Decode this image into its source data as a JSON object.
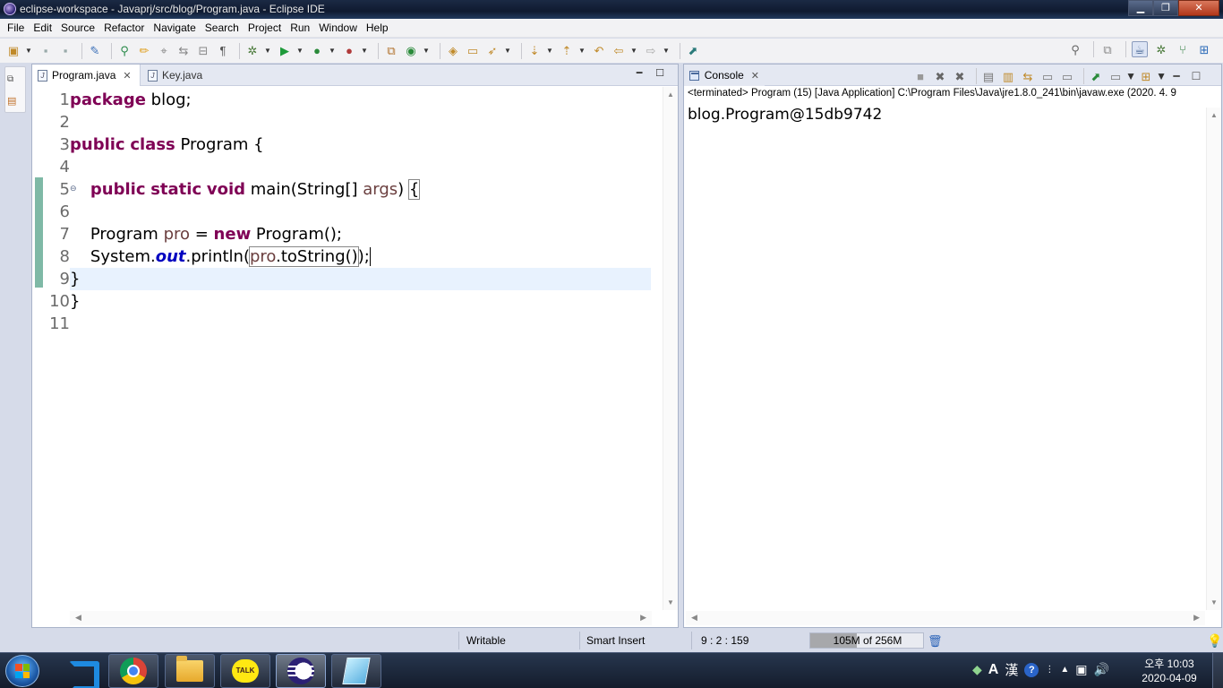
{
  "window": {
    "title": "eclipse-workspace - Javaprj/src/blog/Program.java - Eclipse IDE",
    "minimize_glyph": "▁",
    "maximize_glyph": "❐",
    "close_glyph": "✕"
  },
  "menu": [
    "File",
    "Edit",
    "Source",
    "Refactor",
    "Navigate",
    "Search",
    "Project",
    "Run",
    "Window",
    "Help"
  ],
  "editor": {
    "tabs": [
      {
        "label": "Program.java",
        "active": true
      },
      {
        "label": "Key.java",
        "active": false
      }
    ],
    "tab_close_glyph": "✕",
    "minimize_glyph": "━",
    "maximize_glyph": "☐",
    "line_numbers": [
      "1",
      "2",
      "3",
      "4",
      "5",
      "6",
      "7",
      "8",
      "9",
      "10",
      "11"
    ],
    "fold_glyph": "⊖",
    "code": {
      "l1_kw": "package",
      "l1_rest": " blog;",
      "l3_kw1": "public",
      "l3_kw2": "class",
      "l3_rest": " Program {",
      "l5_indent": "    ",
      "l5_kw1": "public",
      "l5_kw2": "static",
      "l5_kw3": "void",
      "l5_rest": " main(String[] ",
      "l5_param": "args",
      "l5_close": ") ",
      "l5_brace": "{",
      "l7_indent": "    ",
      "l7_type": "Program ",
      "l7_var": "pro",
      "l7_eq": " = ",
      "l7_kw": "new",
      "l7_rest": " Program();",
      "l8_indent": "    ",
      "l8_sys": "System.",
      "l8_field": "out",
      "l8_method": ".println(",
      "l8_arg_var": "pro",
      "l8_arg_rest": ".toString()",
      "l8_end": ");",
      "l9": "}",
      "l10": "}"
    }
  },
  "console": {
    "tab_label": "Console",
    "status": "<terminated> Program (15) [Java Application] C:\\Program Files\\Java\\jre1.8.0_241\\bin\\javaw.exe (2020. 4. 9",
    "output": "blog.Program@15db9742"
  },
  "statusbar": {
    "writable": "Writable",
    "insert_mode": "Smart Insert",
    "position": "9 : 2 : 159",
    "heap_used": "105M of 256M",
    "heap_fraction": 0.41
  },
  "taskbar": {
    "talk_label": "TALK",
    "ime_a": "A",
    "ime_h": "漢",
    "help": "?",
    "clock_time": "오후 10:03",
    "clock_date": "2020-04-09"
  }
}
